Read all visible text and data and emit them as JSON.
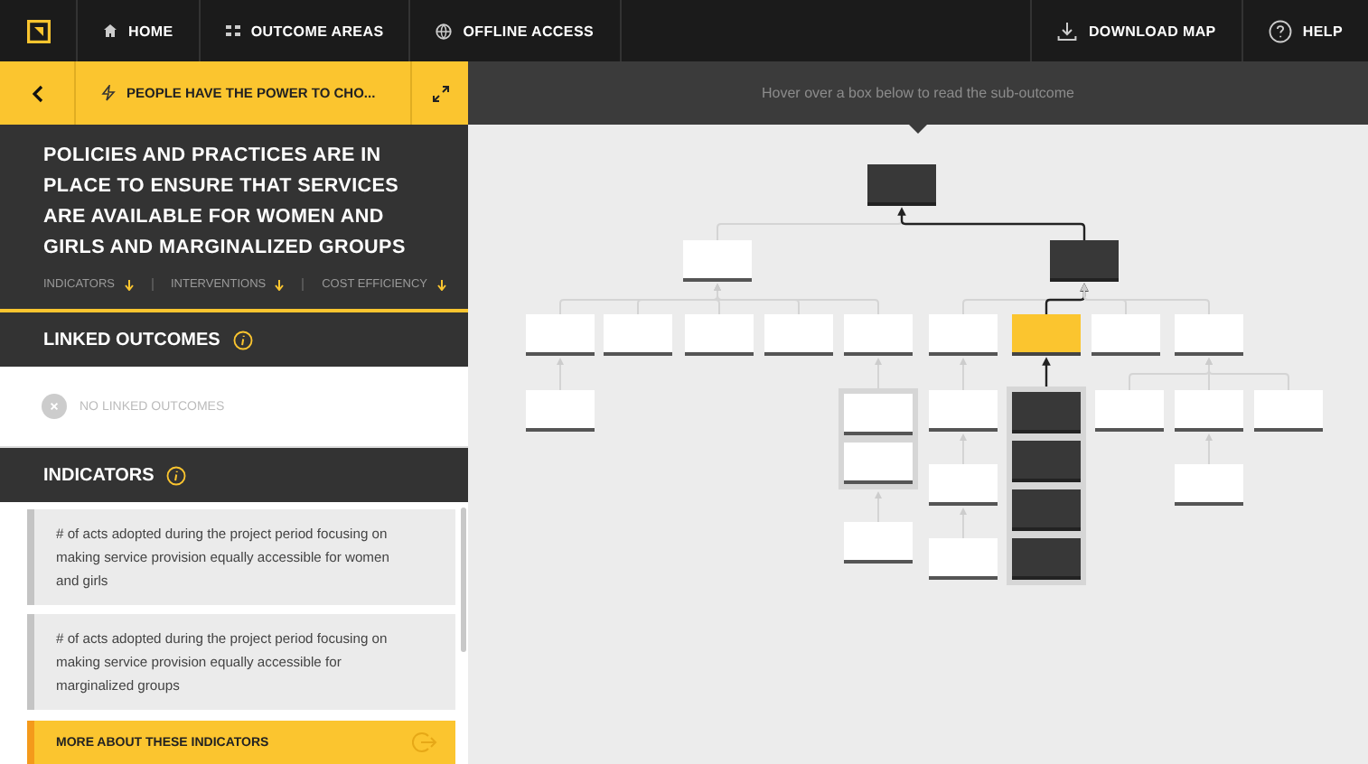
{
  "nav": {
    "items": [
      {
        "label": "HOME"
      },
      {
        "label": "OUTCOME AREAS"
      },
      {
        "label": "OFFLINE ACCESS"
      }
    ],
    "actions": [
      {
        "label": "DOWNLOAD MAP"
      },
      {
        "label": "HELP"
      }
    ]
  },
  "breadcrumb": {
    "label": "PEOPLE HAVE THE POWER TO CHO..."
  },
  "outcome": {
    "title": "POLICIES AND PRACTICES ARE IN PLACE TO ENSURE THAT SERVICES ARE AVAILABLE FOR WOMEN AND GIRLS AND MARGINALIZED GROUPS",
    "links": [
      {
        "label": "INDICATORS"
      },
      {
        "label": "INTERVENTIONS"
      },
      {
        "label": "COST EFFICIENCY"
      }
    ]
  },
  "linked_outcomes": {
    "title": "LINKED OUTCOMES",
    "empty_text": "NO LINKED OUTCOMES"
  },
  "indicators": {
    "title": "INDICATORS",
    "items": [
      {
        "text": "# of acts adopted during the project period focusing on making service provision equally accessible for women and girls"
      },
      {
        "text": "# of acts adopted during the project period focusing on making service provision equally accessible for marginalized groups"
      }
    ],
    "more_button": "MORE ABOUT THESE INDICATORS"
  },
  "map": {
    "hint": "Hover over a box below to read the sub-outcome",
    "tree": {
      "selected": false,
      "on_path": true,
      "stacked": false,
      "children": [
        {
          "selected": false,
          "on_path": false,
          "stacked": false,
          "children": [
            {
              "selected": false,
              "on_path": false,
              "stacked": false,
              "children": [
                {
                  "selected": false,
                  "on_path": false
                }
              ]
            },
            {
              "selected": false,
              "on_path": false
            },
            {
              "selected": false,
              "on_path": false
            },
            {
              "selected": false,
              "on_path": false
            },
            {
              "selected": false,
              "on_path": false,
              "stacked": true,
              "children": [
                {
                  "selected": false,
                  "on_path": false
                },
                {
                  "selected": false,
                  "on_path": false,
                  "stacked": false,
                  "children": [
                    {
                      "selected": false,
                      "on_path": false
                    }
                  ]
                }
              ]
            }
          ]
        },
        {
          "selected": false,
          "on_path": true,
          "stacked": false,
          "children": [
            {
              "selected": false,
              "on_path": false,
              "stacked": false,
              "children": [
                {
                  "selected": false,
                  "on_path": false,
                  "stacked": false,
                  "children": [
                    {
                      "selected": false,
                      "on_path": false,
                      "stacked": false,
                      "children": [
                        {
                          "selected": false,
                          "on_path": false
                        }
                      ]
                    }
                  ]
                }
              ]
            },
            {
              "selected": true,
              "on_path": false,
              "stacked": true,
              "children": [
                {
                  "selected": false,
                  "on_path": true
                },
                {
                  "selected": false,
                  "on_path": true
                },
                {
                  "selected": false,
                  "on_path": true
                },
                {
                  "selected": false,
                  "on_path": true
                }
              ]
            },
            {
              "selected": false,
              "on_path": false
            },
            {
              "selected": false,
              "on_path": false,
              "stacked": false,
              "children": [
                {
                  "selected": false,
                  "on_path": false
                },
                {
                  "selected": false,
                  "on_path": false,
                  "stacked": false,
                  "children": [
                    {
                      "selected": false,
                      "on_path": false
                    }
                  ]
                },
                {
                  "selected": false,
                  "on_path": false
                }
              ]
            }
          ]
        }
      ]
    }
  }
}
